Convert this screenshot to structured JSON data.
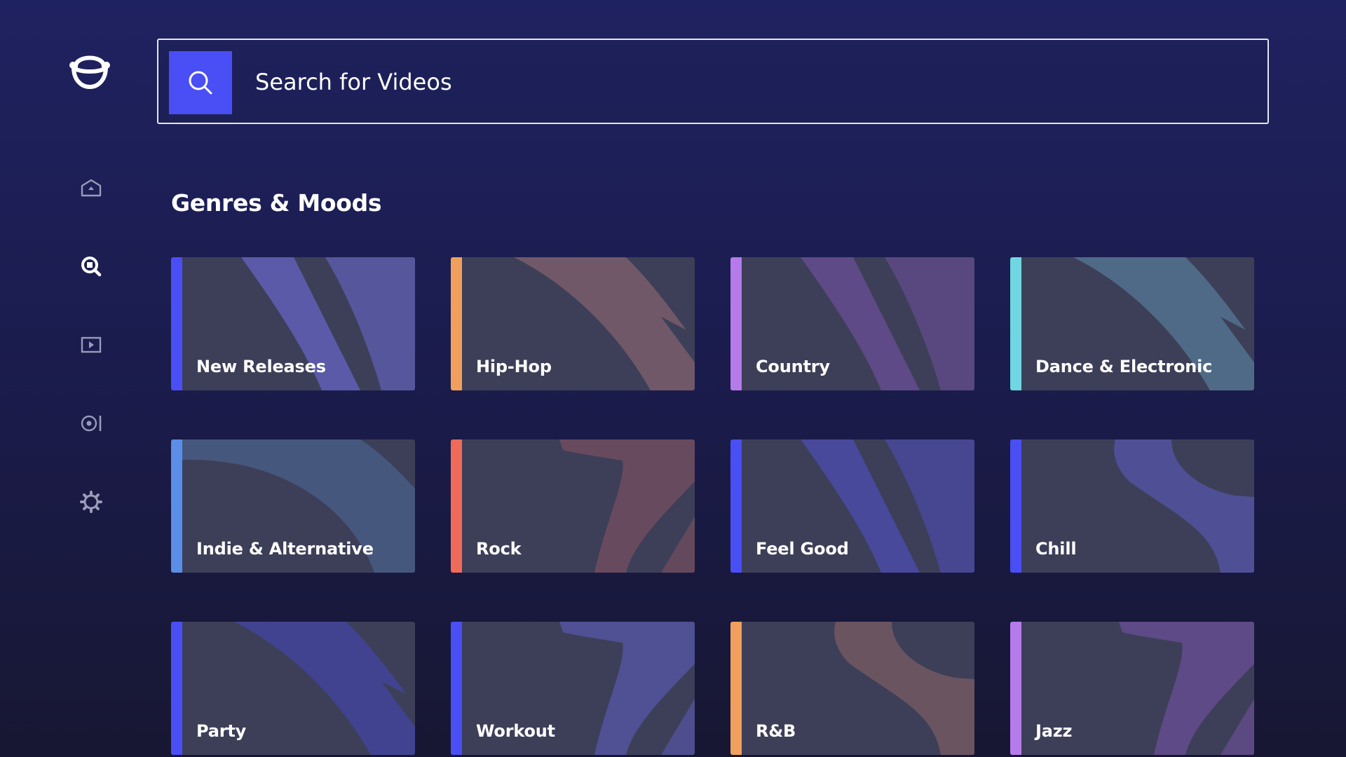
{
  "app": {
    "logo_icon": "headphones-face-logo"
  },
  "nav": {
    "items": [
      {
        "name": "home",
        "icon": "home-icon",
        "active": false
      },
      {
        "name": "search",
        "icon": "search-icon",
        "active": true
      },
      {
        "name": "videos",
        "icon": "play-icon",
        "active": false
      },
      {
        "name": "radio",
        "icon": "radio-icon",
        "active": false
      },
      {
        "name": "settings",
        "icon": "gear-icon",
        "active": false
      }
    ]
  },
  "search": {
    "placeholder": "Search for Videos",
    "button_icon": "search-icon",
    "button_color": "#4a4ef5"
  },
  "section": {
    "title": "Genres & Moods"
  },
  "genres": [
    {
      "label": "New Releases",
      "accent": "#4a4ef5",
      "art": "#5a5aa8",
      "pattern": "stripes"
    },
    {
      "label": "Hip-Hop",
      "accent": "#f0a05c",
      "art": "#705868",
      "pattern": "sweep"
    },
    {
      "label": "Country",
      "accent": "#b57bea",
      "art": "#5e4a86",
      "pattern": "stripes"
    },
    {
      "label": "Dance & Electronic",
      "accent": "#6fd6e2",
      "art": "#4f6a86",
      "pattern": "sweep"
    },
    {
      "label": "Indie & Alternative",
      "accent": "#5a8ee8",
      "art": "#46577e",
      "pattern": "arc"
    },
    {
      "label": "Rock",
      "accent": "#f06a5a",
      "art": "#684a5e",
      "pattern": "seven"
    },
    {
      "label": "Feel Good",
      "accent": "#4a4ef5",
      "art": "#48499a",
      "pattern": "stripes"
    },
    {
      "label": "Chill",
      "accent": "#4a4ef5",
      "art": "#4f4f95",
      "pattern": "swirl"
    },
    {
      "label": "Party",
      "accent": "#4a4ef5",
      "art": "#414390",
      "pattern": "sweep"
    },
    {
      "label": "Workout",
      "accent": "#4a4ef5",
      "art": "#505095",
      "pattern": "seven"
    },
    {
      "label": "R&B",
      "accent": "#f0a05c",
      "art": "#6a5460",
      "pattern": "swirl"
    },
    {
      "label": "Jazz",
      "accent": "#b57bea",
      "art": "#5e4a86",
      "pattern": "seven"
    }
  ]
}
